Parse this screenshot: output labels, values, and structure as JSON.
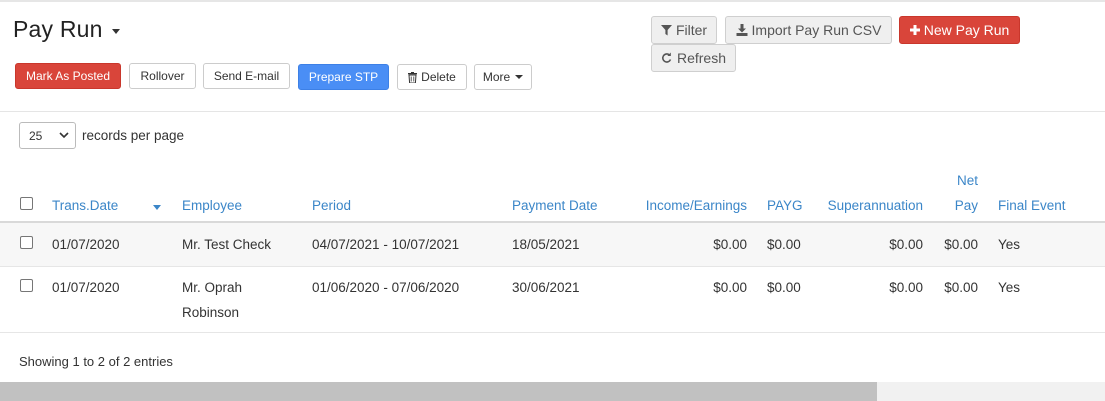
{
  "page": {
    "title": "Pay Run"
  },
  "toolbar": {
    "mark_as_posted": "Mark As Posted",
    "rollover": "Rollover",
    "send_email": "Send E-mail",
    "prepare_stp": "Prepare STP",
    "delete": "Delete",
    "more": "More",
    "filter": "Filter",
    "import_csv": "Import Pay Run CSV",
    "new_pay_run": "New Pay Run",
    "refresh": "Refresh"
  },
  "pager": {
    "page_size": "25",
    "label": "records per page"
  },
  "table": {
    "headers": {
      "trans_date": "Trans.Date",
      "employee": "Employee",
      "period": "Period",
      "payment_date": "Payment Date",
      "income": "Income/Earnings",
      "payg": "PAYG",
      "super": "Superannuation",
      "net_pay_line1": "Net",
      "net_pay_line2": "Pay",
      "final_event": "Final Event"
    },
    "rows": [
      {
        "trans_date": "01/07/2020",
        "employee_line1": "Mr. Test Check",
        "employee_line2": "",
        "period": "04/07/2021 - 10/07/2021",
        "payment_date": "18/05/2021",
        "income": "$0.00",
        "payg": "$0.00",
        "super": "$0.00",
        "net_pay": "$0.00",
        "final_event": "Yes"
      },
      {
        "trans_date": "01/07/2020",
        "employee_line1": "Mr. Oprah",
        "employee_line2": "Robinson",
        "period": "01/06/2020 - 07/06/2020",
        "payment_date": "30/06/2021",
        "income": "$0.00",
        "payg": "$0.00",
        "super": "$0.00",
        "net_pay": "$0.00",
        "final_event": "Yes"
      }
    ]
  },
  "footer": {
    "info": "Showing 1 to 2 of 2 entries"
  },
  "icons": {
    "filter": "filter-icon",
    "import": "download-icon",
    "new": "plus-icon",
    "refresh": "refresh-icon",
    "delete": "trash-icon"
  },
  "colors": {
    "red": "#d9453a",
    "blue": "#4a8ef5",
    "link": "#3b86c8"
  }
}
